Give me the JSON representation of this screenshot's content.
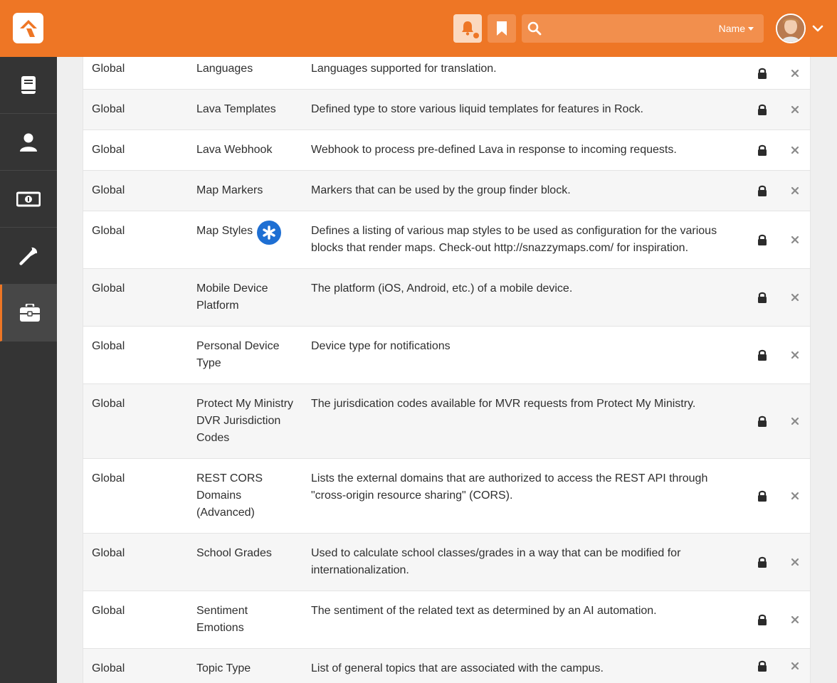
{
  "header": {
    "search_placeholder": "",
    "search_scope": "Name"
  },
  "sidebar": {
    "items": [
      {
        "icon": "book-icon"
      },
      {
        "icon": "person-icon"
      },
      {
        "icon": "money-icon"
      },
      {
        "icon": "wrench-icon"
      },
      {
        "icon": "briefcase-icon",
        "active": true
      }
    ]
  },
  "table": {
    "rows": [
      {
        "category": "Global",
        "name": "Languages",
        "description": "Languages supported for translation."
      },
      {
        "category": "Global",
        "name": "Lava Templates",
        "description": "Defined type to store various liquid templates for features in Rock."
      },
      {
        "category": "Global",
        "name": "Lava Webhook",
        "description": "Webhook to process pre-defined Lava in response to incoming requests."
      },
      {
        "category": "Global",
        "name": "Map Markers",
        "description": "Markers that can be used by the group finder block."
      },
      {
        "category": "Global",
        "name": "Map Styles",
        "description": "Defines a listing of various map styles to be used as configuration for the various blocks that render maps. Check-out http://snazzymaps.com/ for inspiration.",
        "highlight": true
      },
      {
        "category": "Global",
        "name": "Mobile Device Platform",
        "description": "The platform (iOS, Android, etc.) of a mobile device."
      },
      {
        "category": "Global",
        "name": "Personal Device Type",
        "description": "Device type for notifications"
      },
      {
        "category": "Global",
        "name": "Protect My Ministry DVR Jurisdiction Codes",
        "description": "The jurisdication codes available for MVR requests from Protect My Ministry."
      },
      {
        "category": "Global",
        "name": "REST CORS Domains (Advanced)",
        "description": "Lists the external domains that are authorized to access the REST API through \"cross-origin resource sharing\" (CORS)."
      },
      {
        "category": "Global",
        "name": "School Grades",
        "description": "Used to calculate school classes/grades in a way that can be modified for internationalization."
      },
      {
        "category": "Global",
        "name": "Sentiment Emotions",
        "description": "The sentiment of the related text as determined by an AI automation."
      },
      {
        "category": "Global",
        "name": "Topic Type",
        "description": "List of general topics that are associated with the campus."
      }
    ]
  },
  "colors": {
    "brand": "#ee7625",
    "sidebar": "#343434",
    "highlight_badge": "#1e6fd3"
  }
}
